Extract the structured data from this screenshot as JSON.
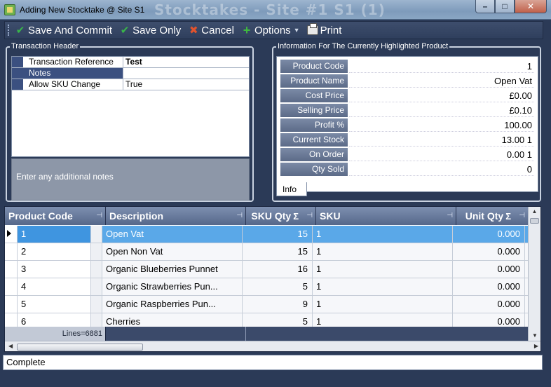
{
  "window": {
    "title": "Adding New Stocktake @ Site S1",
    "background_title": "Stocktakes - Site #1 S1 (1)",
    "minimize": "–",
    "maximize": "□",
    "close": "✕"
  },
  "toolbar": {
    "save_commit": "Save And Commit",
    "save_only": "Save Only",
    "cancel": "Cancel",
    "options": "Options",
    "print": "Print"
  },
  "transaction_header": {
    "legend": "Transaction Header",
    "rows": [
      {
        "key": "Transaction Reference",
        "value": "Test"
      },
      {
        "key": "Notes",
        "value": ""
      },
      {
        "key": "Allow SKU Change",
        "value": "True"
      }
    ],
    "notes_hint": "Enter any additional notes"
  },
  "product_info": {
    "legend": "Information For The Currently Highlighted Product",
    "rows": [
      {
        "key": "Product Code",
        "value": "1"
      },
      {
        "key": "Product Name",
        "value": "Open Vat"
      },
      {
        "key": "Cost Price",
        "value": "£0.00"
      },
      {
        "key": "Selling Price",
        "value": "£0.10"
      },
      {
        "key": "Profit %",
        "value": "100.00"
      },
      {
        "key": "Current Stock",
        "value": "13.00 1"
      },
      {
        "key": "On Order",
        "value": "0.00 1"
      },
      {
        "key": "Qty Sold",
        "value": "0"
      }
    ],
    "tab": "Info"
  },
  "grid": {
    "columns": {
      "code": "Product Code",
      "desc": "Description",
      "skuqty": "SKU Qty",
      "sku": "SKU",
      "unitqty": "Unit Qty"
    },
    "sigma": "Σ",
    "rows": [
      {
        "code": "1",
        "desc": "Open Vat",
        "skuqty": "15",
        "sku": "1",
        "unitqty": "0.000"
      },
      {
        "code": "2",
        "desc": "Open Non Vat",
        "skuqty": "15",
        "sku": "1",
        "unitqty": "0.000"
      },
      {
        "code": "3",
        "desc": "Organic Blueberries Punnet",
        "skuqty": "16",
        "sku": "1",
        "unitqty": "0.000"
      },
      {
        "code": "4",
        "desc": "Organic  Strawberries  Pun...",
        "skuqty": "5",
        "sku": "1",
        "unitqty": "0.000"
      },
      {
        "code": "5",
        "desc": "Organic  Raspberries  Pun...",
        "skuqty": "9",
        "sku": "1",
        "unitqty": "0.000"
      },
      {
        "code": "6",
        "desc": "Cherries",
        "skuqty": "5",
        "sku": "1",
        "unitqty": "0.000"
      }
    ],
    "footer_lines": "Lines=6881"
  },
  "status": {
    "text": "Complete"
  }
}
